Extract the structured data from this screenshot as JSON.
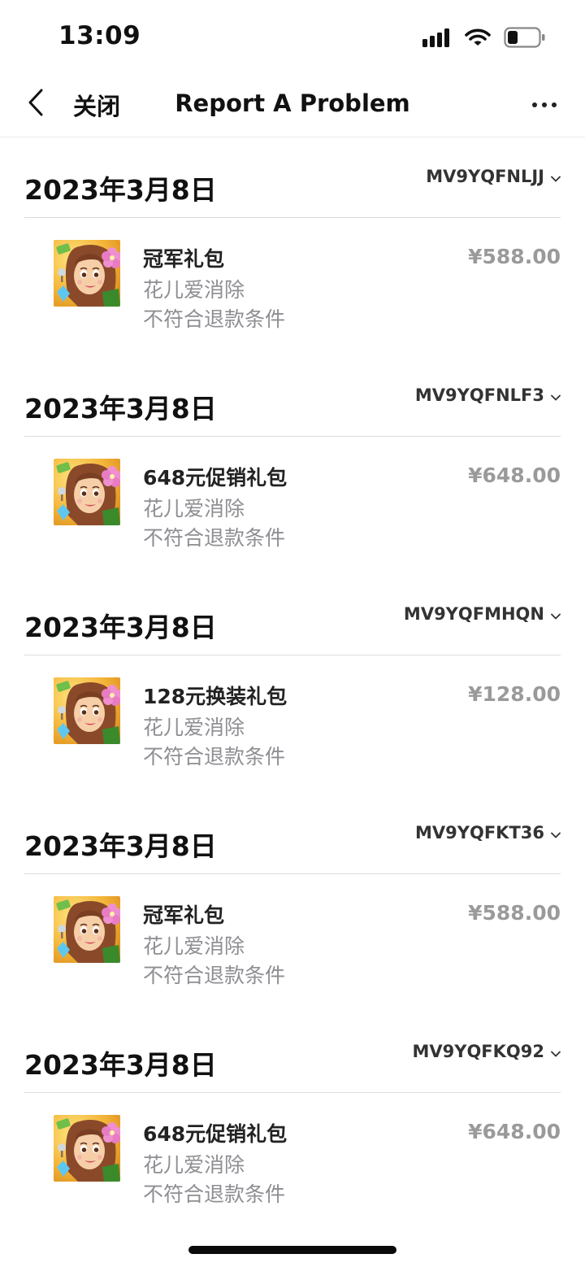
{
  "status_bar": {
    "time": "13:09"
  },
  "nav": {
    "back_label": "关闭",
    "title": "Report A Problem"
  },
  "purchases": [
    {
      "date": "2023年3月8日",
      "order_id": "MV9YQFNLJJ",
      "item": "冠军礼包",
      "app": "花儿爱消除",
      "refund_status": "不符合退款条件",
      "price": "¥588.00"
    },
    {
      "date": "2023年3月8日",
      "order_id": "MV9YQFNLF3",
      "item": "648元促销礼包",
      "app": "花儿爱消除",
      "refund_status": "不符合退款条件",
      "price": "¥648.00"
    },
    {
      "date": "2023年3月8日",
      "order_id": "MV9YQFMHQN",
      "item": "128元换装礼包",
      "app": "花儿爱消除",
      "refund_status": "不符合退款条件",
      "price": "¥128.00"
    },
    {
      "date": "2023年3月8日",
      "order_id": "MV9YQFKT36",
      "item": "冠军礼包",
      "app": "花儿爱消除",
      "refund_status": "不符合退款条件",
      "price": "¥588.00"
    },
    {
      "date": "2023年3月8日",
      "order_id": "MV9YQFKQ92",
      "item": "648元促销礼包",
      "app": "花儿爱消除",
      "refund_status": "不符合退款条件",
      "price": "¥648.00"
    }
  ],
  "icons": {
    "back": "chevron-left-icon",
    "more": "more-dots-icon",
    "order_toggle": "chevron-down-icon",
    "signal": "cellular-signal-icon",
    "wifi": "wifi-icon",
    "battery": "battery-icon",
    "app": "app-icon-flower-girl"
  },
  "colors": {
    "secondary_text": "#8e8e93",
    "price_text": "#9a9a9a",
    "divider": "#dcdcdc"
  },
  "battery_level": 0.2
}
